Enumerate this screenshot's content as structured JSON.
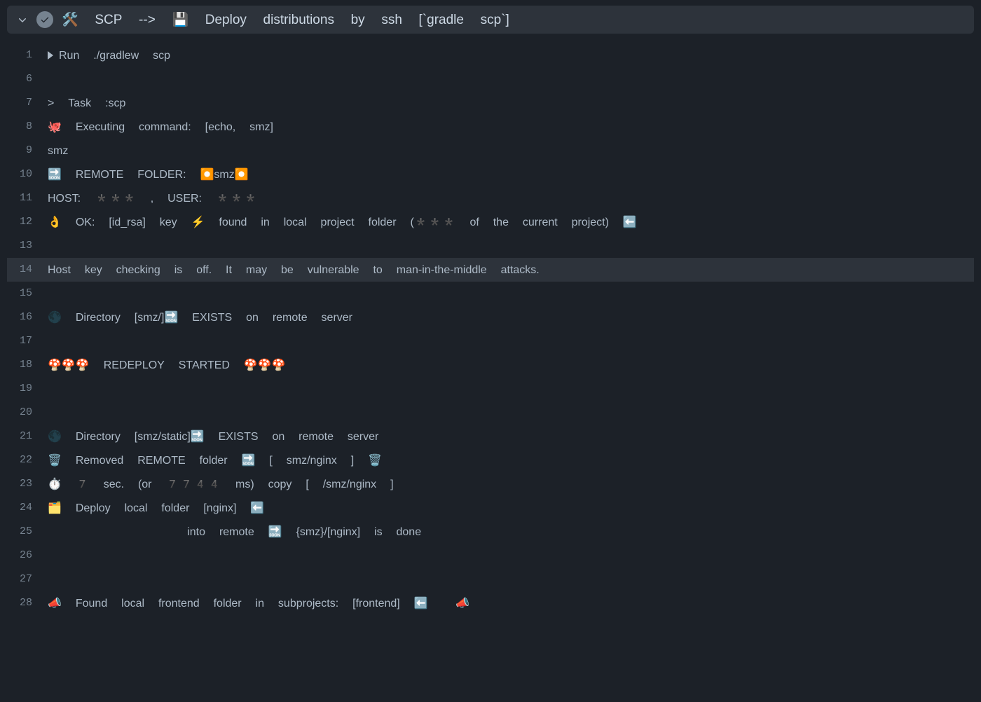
{
  "header": {
    "title": "🛠️ SCP --> 💾 Deploy distributions by ssh [`gradle scp`]"
  },
  "log": {
    "lines": [
      {
        "num": "1",
        "caret": true,
        "highlight": false,
        "text": "Run ./gradlew scp"
      },
      {
        "num": "6",
        "caret": false,
        "highlight": false,
        "text": ""
      },
      {
        "num": "7",
        "caret": false,
        "highlight": false,
        "text": "> Task :scp"
      },
      {
        "num": "8",
        "caret": false,
        "highlight": false,
        "text": "🐙 Executing command: [echo, smz]"
      },
      {
        "num": "9",
        "caret": false,
        "highlight": false,
        "text": "smz"
      },
      {
        "num": "10",
        "caret": false,
        "highlight": false,
        "text": "🔜 REMOTE FOLDER: ⏺smz⏺"
      },
      {
        "num": "11",
        "caret": false,
        "highlight": false,
        "text": "HOST: *** , USER: ***"
      },
      {
        "num": "12",
        "caret": false,
        "highlight": false,
        "text": "👌 OK: [id_rsa] key ⚡ found in local project folder (*** of the current project) ⬅️"
      },
      {
        "num": "13",
        "caret": false,
        "highlight": false,
        "text": ""
      },
      {
        "num": "14",
        "caret": false,
        "highlight": true,
        "text": "Host key checking is off. It may be vulnerable to man-in-the-middle attacks."
      },
      {
        "num": "15",
        "caret": false,
        "highlight": false,
        "text": ""
      },
      {
        "num": "16",
        "caret": false,
        "highlight": false,
        "text": "🌑 Directory [smz/]🔜 EXISTS on remote server"
      },
      {
        "num": "17",
        "caret": false,
        "highlight": false,
        "text": ""
      },
      {
        "num": "18",
        "caret": false,
        "highlight": false,
        "text": "🍄🍄🍄 REDEPLOY STARTED 🍄🍄🍄"
      },
      {
        "num": "19",
        "caret": false,
        "highlight": false,
        "text": ""
      },
      {
        "num": "20",
        "caret": false,
        "highlight": false,
        "text": ""
      },
      {
        "num": "21",
        "caret": false,
        "highlight": false,
        "text": "🌑 Directory [smz/static]🔜 EXISTS on remote server"
      },
      {
        "num": "22",
        "caret": false,
        "highlight": false,
        "text": "🗑️ Removed REMOTE folder 🔜 [ smz/nginx ] 🗑️"
      },
      {
        "num": "23",
        "caret": false,
        "highlight": false,
        "text": "⏱️ 7 sec. (or 7744 ms) copy [ /smz/nginx ]"
      },
      {
        "num": "24",
        "caret": false,
        "highlight": false,
        "text": "🗂️ Deploy local folder [nginx] ⬅️"
      },
      {
        "num": "25",
        "caret": false,
        "highlight": false,
        "text": "          into remote 🔜 {smz}/[nginx] is done"
      },
      {
        "num": "26",
        "caret": false,
        "highlight": false,
        "text": ""
      },
      {
        "num": "27",
        "caret": false,
        "highlight": false,
        "text": ""
      },
      {
        "num": "28",
        "caret": false,
        "highlight": false,
        "text": "📣 Found local frontend folder in subprojects: [frontend] ⬅️  📣"
      }
    ]
  }
}
